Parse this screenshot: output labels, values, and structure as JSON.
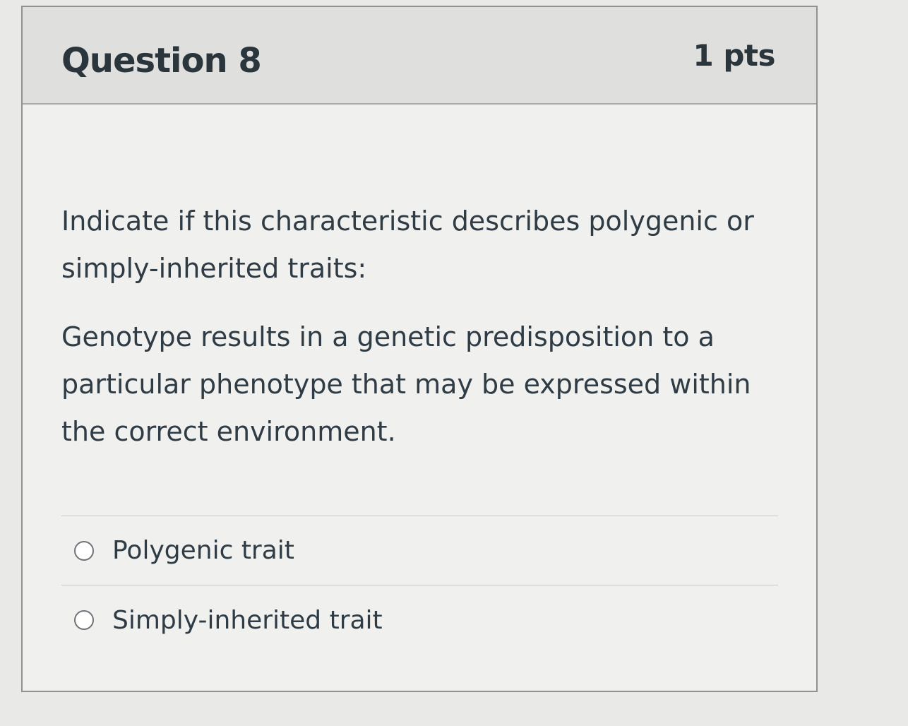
{
  "question": {
    "title": "Question 8",
    "points": "1 pts",
    "prompt": "Indicate if this characteristic describes polygenic or simply-inherited traits:",
    "statement": "Genotype results in a genetic predisposition to a particular phenotype that may be expressed within the correct environment."
  },
  "answers": [
    {
      "label": "Polygenic trait",
      "selected": false
    },
    {
      "label": "Simply-inherited trait",
      "selected": false
    }
  ],
  "icons": {
    "radio": "radio-button-icon"
  }
}
